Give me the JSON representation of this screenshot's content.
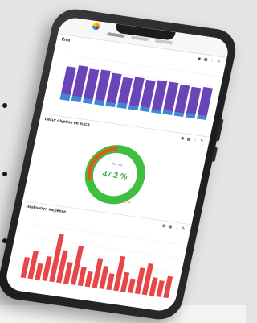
{
  "panel_energie": {
    "title": "Énal",
    "chart_data": {
      "type": "bar",
      "values_a": [
        78,
        86,
        84,
        85,
        83,
        72,
        80,
        76,
        82,
        80,
        78,
        74,
        79
      ],
      "values_b": [
        16,
        15,
        12,
        13,
        10,
        14,
        11,
        12,
        9,
        11,
        10,
        12,
        11
      ],
      "colors": [
        "#6b45b8",
        "#3d86d6"
      ]
    }
  },
  "panel_gauge": {
    "title": "Désur objetion en % CA",
    "gauge_value": 47.2,
    "label_top": "Apt. obj.",
    "label_pct": "47.2 %",
    "label_val": "47.2 %",
    "colors": {
      "track": "#3fbf3f",
      "bg": "#eeeeee",
      "fill": "#e05a1e"
    }
  },
  "panel_reel": {
    "title": "Réalisation incpense",
    "chart_data": {
      "type": "bar",
      "values": [
        38,
        52,
        30,
        45,
        88,
        60,
        40,
        72,
        35,
        28,
        55,
        42,
        30,
        64,
        36,
        26,
        48,
        58,
        34,
        30,
        40
      ],
      "color": "#e8474a"
    }
  },
  "icons": {
    "logo": "app-logo-icon",
    "tools": "panel-tools-icons"
  }
}
